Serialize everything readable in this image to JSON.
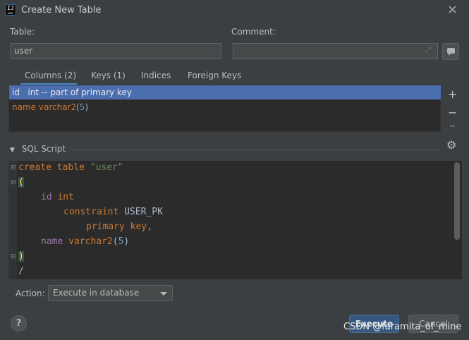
{
  "window": {
    "title": "Create New Table",
    "close_icon": "×"
  },
  "form": {
    "table_label": "Table:",
    "table_value": "user",
    "comment_label": "Comment:",
    "comment_value": ""
  },
  "tabs": [
    {
      "label": "Columns (2)",
      "active": true
    },
    {
      "label": "Keys (1)",
      "active": false
    },
    {
      "label": "Indices",
      "active": false
    },
    {
      "label": "Foreign Keys",
      "active": false
    }
  ],
  "columns": [
    {
      "name": "id",
      "detail": "int -- part of primary key",
      "selected": true
    },
    {
      "name": "name",
      "type": "varchar2",
      "size": "5",
      "selected": false
    }
  ],
  "side_buttons": {
    "add": "+",
    "remove": "−",
    "more": "››"
  },
  "sql_section": {
    "title": "SQL Script",
    "gear_icon": "⚙"
  },
  "sql_code": {
    "l1_kw": "create table",
    "l1_str": "\"user\"",
    "l2": "(",
    "l3_col": "id",
    "l3_type": "int",
    "l4_kw": "constraint",
    "l4_name": "USER_PK",
    "l5_kw": "primary key,",
    "l6_col": "name",
    "l6_type": "varchar2",
    "l6_paren_open": "(",
    "l6_num": "5",
    "l6_paren_close": ")",
    "l7": ")",
    "l8": "/"
  },
  "action": {
    "label": "Action:",
    "selected": "Execute in database"
  },
  "buttons": {
    "help": "?",
    "execute": "Execute",
    "cancel": "Cancel"
  },
  "watermark": "CSDN @faramita_of_mine"
}
